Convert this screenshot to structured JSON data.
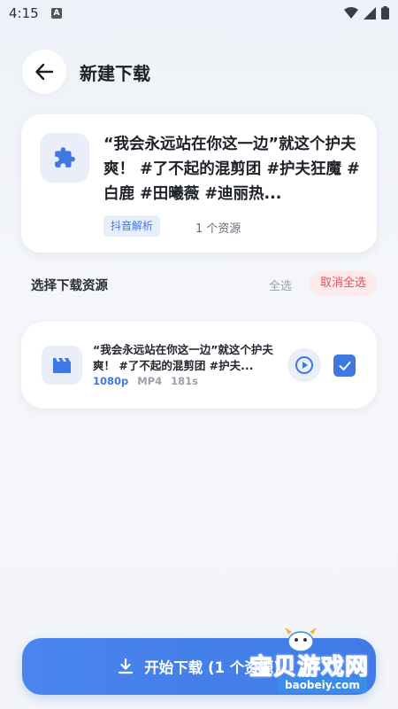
{
  "status_bar": {
    "time": "4:15",
    "notification_badge": "A"
  },
  "header": {
    "title": "新建下载"
  },
  "info_card": {
    "title": "“我会永远站在你这一边”就这个护夫爽！ #了不起的混剪团 #护夫狂魔 #白鹿 #田曦薇 #迪丽热...",
    "source_badge": "抖音解析",
    "resource_count": "1 个资源"
  },
  "section": {
    "title": "选择下载资源",
    "select_all": "全选",
    "deselect_all": "取消全选"
  },
  "resources": [
    {
      "title": "“我会永远站在你这一边”就这个护夫爽！ #了不起的混剪团 #护夫...",
      "quality": "1080p",
      "format": "MP4",
      "duration": "181s",
      "selected": true
    }
  ],
  "bottom_button": {
    "label": "开始下载 (1 个资源)"
  },
  "watermark": {
    "text": "宝贝游戏网",
    "url": "baobeiy.com"
  },
  "colors": {
    "accent": "#3f78e0",
    "danger": "#e2535c",
    "tile_bg": "#e9eef8"
  },
  "icons": {
    "back": "arrow-left-icon",
    "plugin": "puzzle-icon",
    "video": "clapperboard-icon",
    "play": "play-circle-icon",
    "check": "check-icon",
    "download": "download-icon"
  }
}
